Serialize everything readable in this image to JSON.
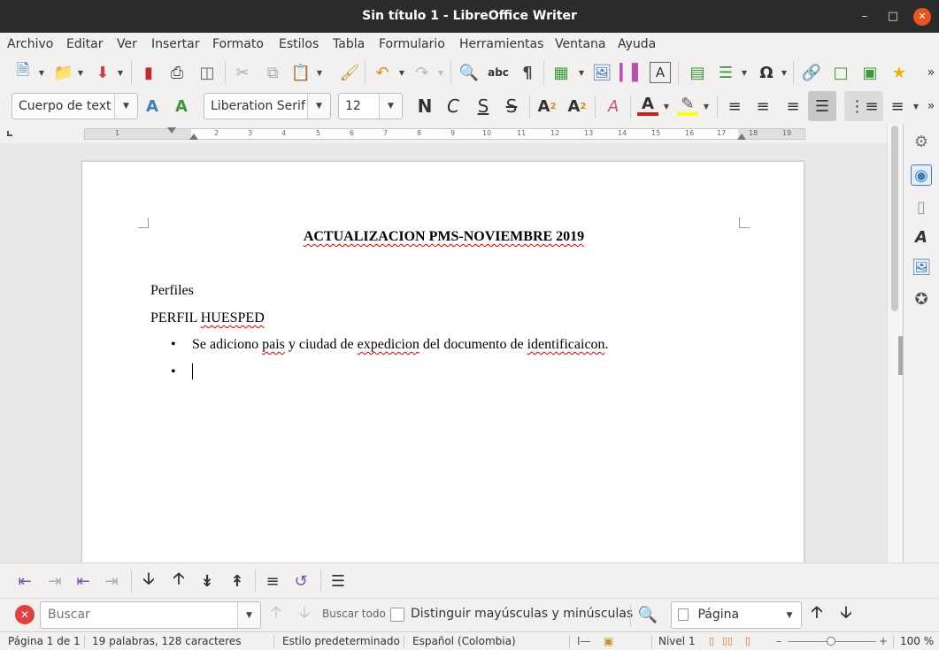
{
  "window": {
    "title": "Sin título 1 - LibreOffice Writer"
  },
  "menu": [
    "Archivo",
    "Editar",
    "Ver",
    "Insertar",
    "Formato",
    "Estilos",
    "Tabla",
    "Formulario",
    "Herramientas",
    "Ventana",
    "Ayuda"
  ],
  "format_bar": {
    "paragraph_style": "Cuerpo de text",
    "font_name": "Liberation Serif",
    "font_size": "12",
    "bold_label": "N",
    "italic_label": "C",
    "underline_label": "S",
    "strike_label": "S"
  },
  "ruler": {
    "numbers": [
      "1",
      "1",
      "2",
      "3",
      "4",
      "5",
      "6",
      "7",
      "8",
      "9",
      "10",
      "11",
      "12",
      "13",
      "14",
      "15",
      "16",
      "17",
      "18",
      "19"
    ]
  },
  "document": {
    "title": "ACTUALIZACION PMS-NOVIEMBRE 2019",
    "para1": "Perfiles",
    "para2_a": "PERFIL ",
    "para2_b": "HUESPED",
    "bullet": "•",
    "bullet1_a": "Se adiciono ",
    "bullet1_b": "pais",
    "bullet1_c": " y ciudad de ",
    "bullet1_d": "expedicion",
    "bullet1_e": " del documento de ",
    "bullet1_f": "identificaicon",
    "bullet1_g": "."
  },
  "find_bar": {
    "placeholder": "Buscar",
    "find_all": "Buscar todo",
    "match_case": "Distinguir mayúsculas y minúsculas",
    "search_scope": "Página"
  },
  "status": {
    "page": "Página 1 de 1",
    "words": "19 palabras, 128 caracteres",
    "page_style": "Estilo predeterminado",
    "language": "Español (Colombia)",
    "outline_level": "Nivel 1",
    "zoom": "100 %"
  },
  "colors": {
    "titlebar": "#2c2c2c",
    "close_button": "#e95420",
    "font_color": "#c9211e",
    "highlight": "#ffff00",
    "spell_underline": "#dd0000"
  }
}
